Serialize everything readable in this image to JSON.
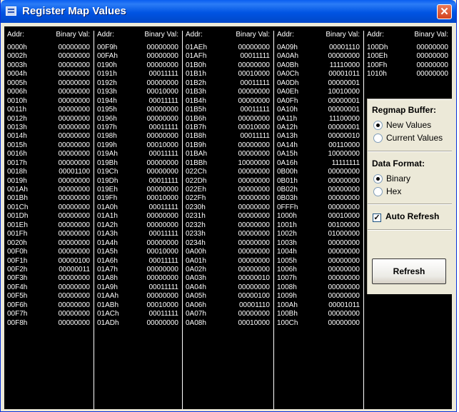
{
  "window": {
    "title": "Register Map Values"
  },
  "headers": {
    "addr": "Addr:",
    "value": "Binary Val:"
  },
  "columns": [
    {
      "rows": [
        [
          "0000h",
          "00000000"
        ],
        [
          "0002h",
          "00000000"
        ],
        [
          "0003h",
          "00000000"
        ],
        [
          "0004h",
          "00000000"
        ],
        [
          "0005h",
          "00000000"
        ],
        [
          "0006h",
          "00000000"
        ],
        [
          "0010h",
          "00000000"
        ],
        [
          "0011h",
          "00000000"
        ],
        [
          "0012h",
          "00000000"
        ],
        [
          "0013h",
          "00000000"
        ],
        [
          "0014h",
          "00000000"
        ],
        [
          "0015h",
          "00000000"
        ],
        [
          "0016h",
          "00000000"
        ],
        [
          "0017h",
          "00000000"
        ],
        [
          "0018h",
          "00001100"
        ],
        [
          "0019h",
          "00000000"
        ],
        [
          "001Ah",
          "00000000"
        ],
        [
          "001Bh",
          "00000000"
        ],
        [
          "001Ch",
          "00000000"
        ],
        [
          "001Dh",
          "00000000"
        ],
        [
          "001Eh",
          "00000000"
        ],
        [
          "001Fh",
          "00000000"
        ],
        [
          "0020h",
          "00000000"
        ],
        [
          "00F0h",
          "00000000"
        ],
        [
          "00F1h",
          "00000100"
        ],
        [
          "00F2h",
          "00000011"
        ],
        [
          "00F3h",
          "00000000"
        ],
        [
          "00F4h",
          "00000000"
        ],
        [
          "00F5h",
          "00000000"
        ],
        [
          "00F6h",
          "00000000"
        ],
        [
          "00F7h",
          "00000000"
        ],
        [
          "00F8h",
          "00000000"
        ]
      ]
    },
    {
      "rows": [
        [
          "00F9h",
          "00000000"
        ],
        [
          "00FAh",
          "00000000"
        ],
        [
          "0190h",
          "00000000"
        ],
        [
          "0191h",
          "00011111"
        ],
        [
          "0192h",
          "00000000"
        ],
        [
          "0193h",
          "00010000"
        ],
        [
          "0194h",
          "00011111"
        ],
        [
          "0195h",
          "00000000"
        ],
        [
          "0196h",
          "00000000"
        ],
        [
          "0197h",
          "00011111"
        ],
        [
          "0198h",
          "00000000"
        ],
        [
          "0199h",
          "00010000"
        ],
        [
          "019Ah",
          "00011111"
        ],
        [
          "019Bh",
          "00000000"
        ],
        [
          "019Ch",
          "00000000"
        ],
        [
          "019Dh",
          "00011111"
        ],
        [
          "019Eh",
          "00000000"
        ],
        [
          "019Fh",
          "00010000"
        ],
        [
          "01A0h",
          "00011111"
        ],
        [
          "01A1h",
          "00000000"
        ],
        [
          "01A2h",
          "00000000"
        ],
        [
          "01A3h",
          "00011111"
        ],
        [
          "01A4h",
          "00000000"
        ],
        [
          "01A5h",
          "00010000"
        ],
        [
          "01A6h",
          "00011111"
        ],
        [
          "01A7h",
          "00000000"
        ],
        [
          "01A8h",
          "00000000"
        ],
        [
          "01A9h",
          "00011111"
        ],
        [
          "01AAh",
          "00000000"
        ],
        [
          "01ABh",
          "00010000"
        ],
        [
          "01ACh",
          "00011111"
        ],
        [
          "01ADh",
          "00000000"
        ]
      ]
    },
    {
      "rows": [
        [
          "01AEh",
          "00000000"
        ],
        [
          "01AFh",
          "00011111"
        ],
        [
          "01B0h",
          "00000000"
        ],
        [
          "01B1h",
          "00010000"
        ],
        [
          "01B2h",
          "00011111"
        ],
        [
          "01B3h",
          "00000000"
        ],
        [
          "01B4h",
          "00000000"
        ],
        [
          "01B5h",
          "00011111"
        ],
        [
          "01B6h",
          "00000000"
        ],
        [
          "01B7h",
          "00010000"
        ],
        [
          "01B8h",
          "00011111"
        ],
        [
          "01B9h",
          "00000000"
        ],
        [
          "01BAh",
          "00000000"
        ],
        [
          "01BBh",
          "10000000"
        ],
        [
          "022Ch",
          "00000000"
        ],
        [
          "022Dh",
          "00000000"
        ],
        [
          "022Eh",
          "00000000"
        ],
        [
          "022Fh",
          "00000000"
        ],
        [
          "0230h",
          "00000000"
        ],
        [
          "0231h",
          "00000000"
        ],
        [
          "0232h",
          "00000000"
        ],
        [
          "0233h",
          "00000000"
        ],
        [
          "0234h",
          "00000000"
        ],
        [
          "0A00h",
          "00000000"
        ],
        [
          "0A01h",
          "00000000"
        ],
        [
          "0A02h",
          "00000000"
        ],
        [
          "0A03h",
          "00000010"
        ],
        [
          "0A04h",
          "00000000"
        ],
        [
          "0A05h",
          "00000100"
        ],
        [
          "0A06h",
          "00001110"
        ],
        [
          "0A07h",
          "00000000"
        ],
        [
          "0A08h",
          "00010000"
        ]
      ]
    },
    {
      "rows": [
        [
          "0A09h",
          "00001110"
        ],
        [
          "0A0Ah",
          "00000000"
        ],
        [
          "0A0Bh",
          "11110000"
        ],
        [
          "0A0Ch",
          "00001011"
        ],
        [
          "0A0Dh",
          "00000001"
        ],
        [
          "0A0Eh",
          "10010000"
        ],
        [
          "0A0Fh",
          "00000001"
        ],
        [
          "0A10h",
          "00000001"
        ],
        [
          "0A11h",
          "11100000"
        ],
        [
          "0A12h",
          "00000001"
        ],
        [
          "0A13h",
          "00000010"
        ],
        [
          "0A14h",
          "00110000"
        ],
        [
          "0A15h",
          "10000000"
        ],
        [
          "0A16h",
          "11111111"
        ],
        [
          "0B00h",
          "00000000"
        ],
        [
          "0B01h",
          "00000000"
        ],
        [
          "0B02h",
          "00000000"
        ],
        [
          "0B03h",
          "00000000"
        ],
        [
          "0FFFh",
          "00000000"
        ],
        [
          "1000h",
          "00010000"
        ],
        [
          "1001h",
          "00100000"
        ],
        [
          "1002h",
          "01000000"
        ],
        [
          "1003h",
          "00000000"
        ],
        [
          "1004h",
          "00000000"
        ],
        [
          "1005h",
          "00000000"
        ],
        [
          "1006h",
          "00000000"
        ],
        [
          "1007h",
          "00000000"
        ],
        [
          "1008h",
          "00000000"
        ],
        [
          "1009h",
          "00000000"
        ],
        [
          "100Ah",
          "00001011"
        ],
        [
          "100Bh",
          "00000000"
        ],
        [
          "100Ch",
          "00000000"
        ]
      ]
    },
    {
      "rows": [
        [
          "100Dh",
          "00000000"
        ],
        [
          "100Eh",
          "00000000"
        ],
        [
          "100Fh",
          "00000000"
        ],
        [
          "1010h",
          "00000000"
        ]
      ]
    }
  ],
  "regmap_buffer": {
    "title": "Regmap Buffer:",
    "options": [
      "New Values",
      "Current Values"
    ],
    "selected": "New Values"
  },
  "data_format": {
    "title": "Data Format:",
    "options": [
      "Binary",
      "Hex"
    ],
    "selected": "Binary"
  },
  "auto_refresh": {
    "label": "Auto Refresh",
    "checked": true
  },
  "refresh_button": {
    "label": "Refresh"
  }
}
